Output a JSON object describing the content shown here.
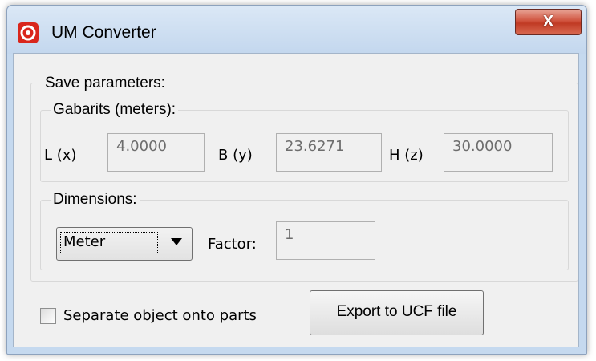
{
  "window": {
    "title": "UM Converter",
    "close_label": "X"
  },
  "save_group": {
    "label": "Save parameters:"
  },
  "gabarits": {
    "label": "Gabarits (meters):",
    "l_label": "L (x)",
    "l_value": "4.0000",
    "b_label": "B (y)",
    "b_value": "23.6271",
    "h_label": "H (z)",
    "h_value": "30.0000"
  },
  "dimensions": {
    "label": "Dimensions:",
    "unit_selected": "Meter",
    "factor_label": "Factor:",
    "factor_value": "1"
  },
  "footer": {
    "separate_label": "Separate object onto parts",
    "separate_checked": false,
    "export_label": "Export to UCF file"
  },
  "icons": {
    "app": "um-app-icon",
    "close": "close-icon",
    "dropdown": "chevron-down-icon"
  },
  "colors": {
    "titlebar": "#c5d9ef",
    "close_button": "#c8442e",
    "app_icon": "#d9261c",
    "client_bg": "#f0f0f0"
  }
}
